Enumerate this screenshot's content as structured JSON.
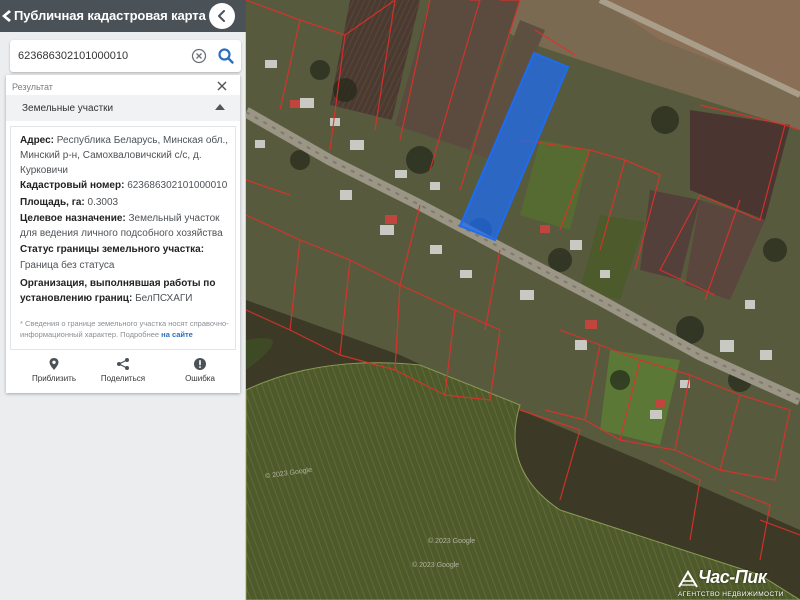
{
  "app": {
    "title": "Публичная кадастровая карта"
  },
  "search": {
    "value": "623686302101000010",
    "placeholder": ""
  },
  "result": {
    "header": "Результат",
    "section_label": "Земельные участки",
    "details": {
      "address_label": "Адрес:",
      "address_value": "Республика Беларусь, Минская обл., Минский р-н, Самохваловичский с/с, д. Курковичи",
      "cadastral_label": "Кадастровый номер:",
      "cadastral_value": "623686302101000010",
      "area_label": "Площадь, га:",
      "area_value": "0.3003",
      "purpose_label": "Целевое назначение:",
      "purpose_value": "Земельный участок для ведения личного подсобного хозяйства",
      "boundary_label": "Статус границы земельного участка:",
      "boundary_value": "Граница без статуса",
      "org_label": "Организация, выполнявшая работы по установлению границ:",
      "org_value": "БелПСХАГИ",
      "footnote": "* Сведения о границе земельного участка носят справочно-информационный характер. Подробнее",
      "footnote_link": "на сайте"
    },
    "actions": [
      {
        "label": "Приблизить",
        "icon": "location-pin-icon"
      },
      {
        "label": "Поделиться",
        "icon": "share-icon"
      },
      {
        "label": "Ошибка",
        "icon": "error-icon"
      }
    ]
  },
  "map": {
    "imagery_credits": [
      "© 2023 Google",
      "© 2023 Google",
      "© 2023 Google"
    ],
    "highlight_color": "#1e6cf0",
    "parcel_border_color": "#e0302a"
  },
  "watermark": {
    "name": "Час-Пик",
    "subtitle": "АГЕНТСТВО НЕДВИЖИМОСТИ"
  },
  "colors": {
    "title_bar": "#4b5257",
    "panel_bg": "#ebedef",
    "link": "#2a6fbf",
    "search_icon": "#2a6fbf"
  }
}
